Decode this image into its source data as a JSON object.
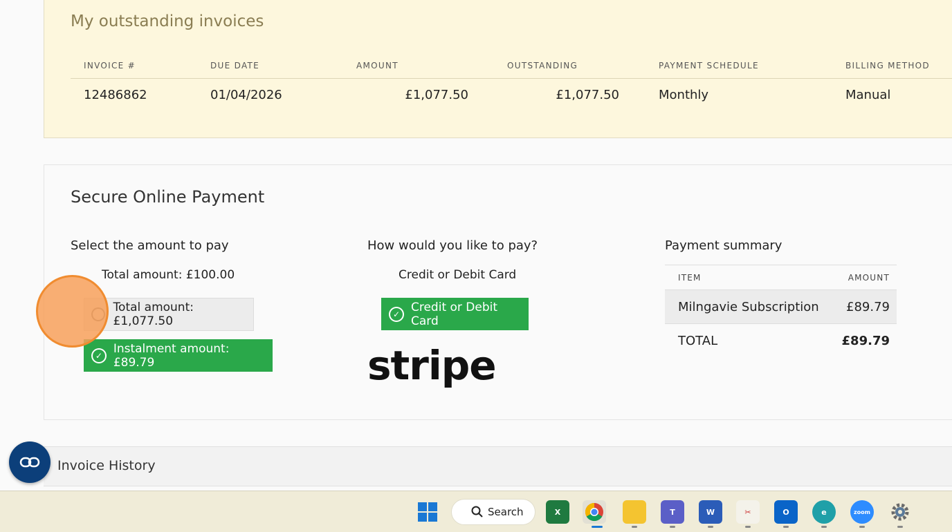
{
  "invoices": {
    "title": "My outstanding invoices",
    "headers": [
      "INVOICE #",
      "DUE DATE",
      "AMOUNT",
      "OUTSTANDING",
      "PAYMENT SCHEDULE",
      "BILLING METHOD"
    ],
    "rows": [
      [
        "12486862",
        "01/04/2026",
        "£1,077.50",
        "£1,077.50",
        "Monthly",
        "Manual"
      ]
    ]
  },
  "payment": {
    "title": "Secure Online Payment",
    "amount_section": {
      "heading": "Select the amount to pay",
      "total_label": "Total amount: £100.00",
      "option_total": "Total amount: £1,077.50",
      "option_instalment": "Instalment amount: £89.79"
    },
    "method_section": {
      "heading": "How would you like to pay?",
      "subtitle": "Credit or Debit Card",
      "button": "Credit or Debit Card",
      "provider_logo": "stripe"
    },
    "summary": {
      "heading": "Payment summary",
      "col_item": "ITEM",
      "col_amount": "AMOUNT",
      "item_name": "Milngavie Subscription",
      "item_amount": "£89.79",
      "total_label": "TOTAL",
      "total_amount": "£89.79"
    }
  },
  "history": {
    "title": "Invoice History"
  },
  "taskbar": {
    "search_label": "Search",
    "apps": [
      "windows-start-icon",
      "excel-icon",
      "chrome-icon",
      "file-explorer-icon",
      "teams-icon",
      "word-icon",
      "snipping-tool-icon",
      "outlook-icon",
      "edge-icon",
      "zoom-icon",
      "settings-icon"
    ]
  },
  "colors": {
    "accent_green": "#2aa84a",
    "panel_cream": "#fdf7dd",
    "fab_blue": "#0c3f7a"
  }
}
